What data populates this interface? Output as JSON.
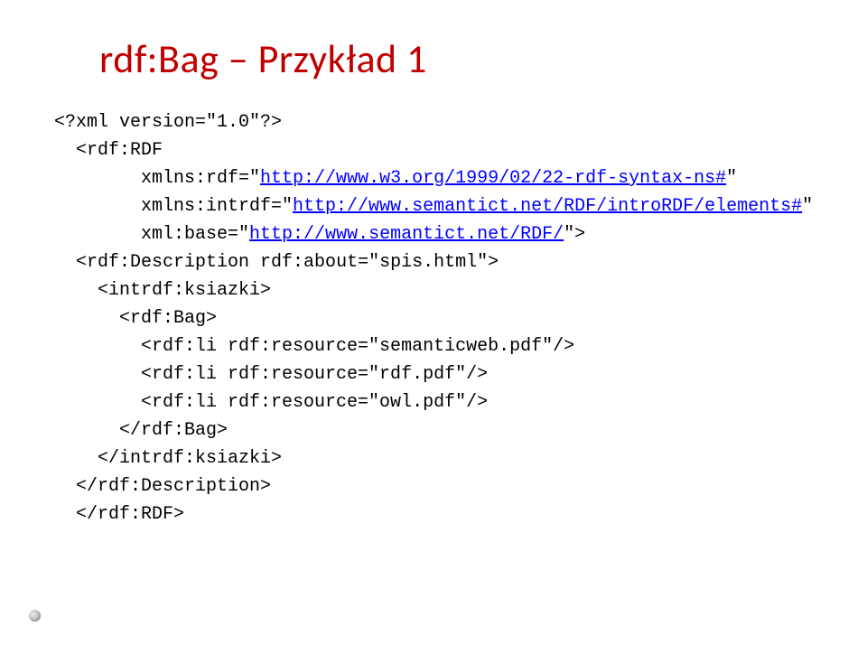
{
  "title": "rdf:Bag – Przykład 1",
  "code": {
    "l1": "<?xml version=\"1.0\"?>",
    "l2": "<rdf:RDF",
    "l3a": "xmlns:rdf=\"",
    "l3link": "http://www.w3.org/1999/02/22-rdf-syntax-ns#",
    "l3b": "\"",
    "l4a": "xmlns:intrdf=\"",
    "l4link": "http://www.semantict.net/RDF/introRDF/elements#",
    "l4b": "\"",
    "l5a": "xml:base=\"",
    "l5link": "http://www.semantict.net/RDF/",
    "l5b": "\">",
    "l6": "<rdf:Description rdf:about=\"spis.html\">",
    "l7": "<intrdf:ksiazki>",
    "l8": "<rdf:Bag>",
    "l9": "<rdf:li rdf:resource=\"semanticweb.pdf\"/>",
    "l10": "<rdf:li rdf:resource=\"rdf.pdf\"/>",
    "l11": "<rdf:li rdf:resource=\"owl.pdf\"/>",
    "l12": "</rdf:Bag>",
    "l13": "</intrdf:ksiazki>",
    "l14": "</rdf:Description>",
    "l15": "</rdf:RDF>"
  }
}
